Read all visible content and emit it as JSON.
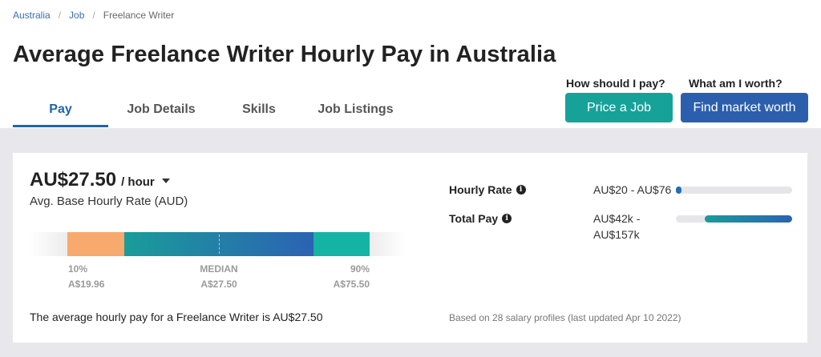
{
  "breadcrumb": {
    "items": [
      {
        "label": "Australia"
      },
      {
        "label": "Job"
      }
    ],
    "current": "Freelance Writer"
  },
  "page": {
    "title": "Average Freelance Writer Hourly Pay in Australia"
  },
  "tabs": [
    {
      "label": "Pay",
      "active": true
    },
    {
      "label": "Job Details",
      "active": false
    },
    {
      "label": "Skills",
      "active": false
    },
    {
      "label": "Job Listings",
      "active": false
    }
  ],
  "cta": {
    "price_question": "How should I pay?",
    "price_button": "Price a Job",
    "market_question": "What am I worth?",
    "market_button": "Find market worth"
  },
  "summary": {
    "rate": "AU$27.50",
    "unit": "/ hour",
    "subtitle": "Avg. Base Hourly Rate (AUD)",
    "caret_icon": "caret-down-icon"
  },
  "distribution": {
    "low_label": "10%",
    "low_value": "A$19.96",
    "median_label": "MEDIAN",
    "median_value": "A$27.50",
    "high_label": "90%",
    "high_value": "A$75.50"
  },
  "average_text": "The average hourly pay for a Freelance Writer is AU$27.50",
  "stats": {
    "hourly_label": "Hourly Rate",
    "hourly_value": "AU$20 - AU$76",
    "total_label": "Total Pay",
    "total_value": "AU$42k - AU$157k",
    "info_icon": "info-icon"
  },
  "based_on": "Based on 28 salary profiles (last updated Apr 10 2022)",
  "colors": {
    "primary_blue": "#2b5fae",
    "teal": "#16a299",
    "orange": "#f8a96e",
    "tab_active": "#1e63b0"
  }
}
